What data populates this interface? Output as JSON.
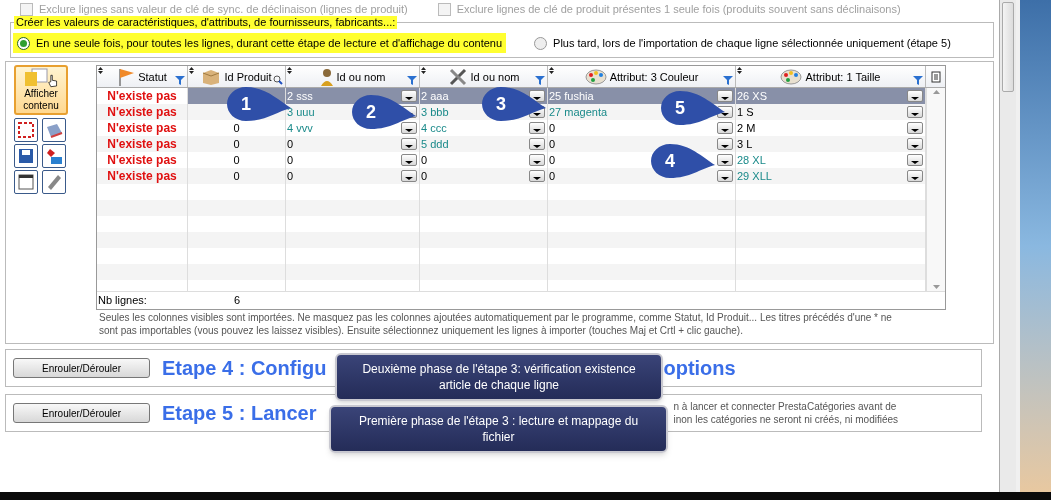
{
  "top_options": [
    {
      "label": "Exclure lignes sans valeur de clé de sync. de déclinaison (lignes de produit)",
      "checked": false,
      "disabled": true
    },
    {
      "label": "Exclure lignes de clé de produit présentes 1 seule fois (produits souvent sans déclinaisons)",
      "checked": false,
      "disabled": true
    }
  ],
  "creation_group": {
    "legend": "Créer les valeurs de caractéristiques, d'attributs, de fournisseurs, fabricants...:",
    "options": [
      {
        "label": "En une seule fois, pour toutes les lignes, durant cette étape de lecture et d'affichage du contenu",
        "selected": true
      },
      {
        "label": "Plus tard, lors de l'importation de chaque ligne sélectionnée uniquement (étape 5)",
        "selected": false
      }
    ]
  },
  "show_button": {
    "label": "Afficher contenu"
  },
  "grid": {
    "columns": [
      {
        "label": "Statut"
      },
      {
        "label": "Id Produit"
      },
      {
        "label": "Id ou nom"
      },
      {
        "label": "Id ou nom"
      },
      {
        "label": "Attribut: 3 Couleur"
      },
      {
        "label": "Attribut: 1 Taille"
      }
    ],
    "rows": [
      {
        "selected": true,
        "cells": [
          {
            "text": "N'existe pas"
          },
          {
            "text": null
          },
          {
            "text": "2 sss"
          },
          {
            "text": "2 aaa"
          },
          {
            "text": "25 fushia"
          },
          {
            "text": "26 XS"
          }
        ]
      },
      {
        "selected": false,
        "cells": [
          {
            "text": "N'existe pas"
          },
          {
            "text": null
          },
          {
            "text": "3 uuu",
            "new": true
          },
          {
            "text": "3 bbb",
            "new": true
          },
          {
            "text": "27 magenta",
            "new": true
          },
          {
            "text": "1 S",
            "new": false
          }
        ]
      },
      {
        "selected": false,
        "cells": [
          {
            "text": "N'existe pas"
          },
          {
            "text": "0"
          },
          {
            "text": "4 vvv",
            "new": true
          },
          {
            "text": "4 ccc",
            "new": true
          },
          {
            "text": "0",
            "new": false
          },
          {
            "text": "2 M",
            "new": false
          }
        ]
      },
      {
        "selected": false,
        "cells": [
          {
            "text": "N'existe pas"
          },
          {
            "text": "0"
          },
          {
            "text": "0",
            "new": false
          },
          {
            "text": "5 ddd",
            "new": true
          },
          {
            "text": "0",
            "new": false
          },
          {
            "text": "3 L",
            "new": false
          }
        ]
      },
      {
        "selected": false,
        "cells": [
          {
            "text": "N'existe pas"
          },
          {
            "text": "0"
          },
          {
            "text": "0",
            "new": false
          },
          {
            "text": "0",
            "new": false
          },
          {
            "text": "0",
            "new": false
          },
          {
            "text": "28 XL",
            "new": true
          }
        ]
      },
      {
        "selected": false,
        "cells": [
          {
            "text": "N'existe pas"
          },
          {
            "text": "0"
          },
          {
            "text": "0",
            "new": false
          },
          {
            "text": "0",
            "new": false
          },
          {
            "text": "0",
            "new": false
          },
          {
            "text": "29 XLL",
            "new": true
          }
        ]
      }
    ],
    "footer_label": "Nb lignes:",
    "footer_count": "6"
  },
  "note": "Seules les colonnes visibles sont importées. Ne masquez pas les colonnes ajoutées automatiquement par le programme, comme Statut, Id Produit... Les titres précédés d'une * ne sont pas importables (vous pouvez les laissez  visibles).  Ensuite sélectionnez uniquement les lignes à importer (touches Maj et Crtl + clic gauche).",
  "steps": [
    {
      "button": "Enrouler/Dérouler",
      "title": "Etape 4 : Configu",
      "title_tail": "options"
    },
    {
      "button": "Enrouler/Dérouler",
      "title": "Etape 5 : Lancer",
      "desc": [
        "n à lancer et connecter PrestaCatégories avant de",
        "inon les catégories ne seront ni créés, ni modifiées"
      ]
    }
  ],
  "tooltips": [
    "Deuxième phase de l'étape 3: vérification existence article de chaque ligne",
    "Première phase de l'étape 3 : lecture et mappage du fichier"
  ],
  "callouts": [
    {
      "number": "1"
    },
    {
      "number": "2"
    },
    {
      "number": "3"
    },
    {
      "number": "5"
    },
    {
      "number": "4"
    }
  ]
}
